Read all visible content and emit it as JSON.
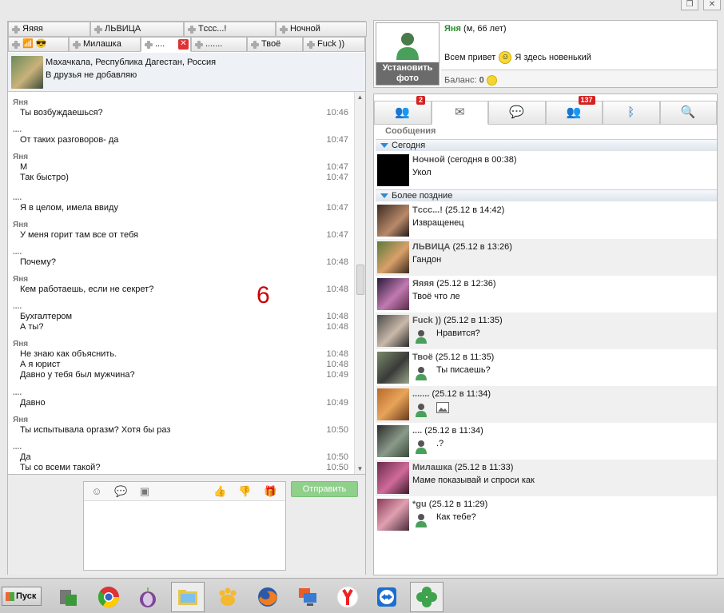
{
  "window_controls": [
    "restore",
    "close"
  ],
  "tabs_row1": [
    {
      "label": "Яяяя"
    },
    {
      "label": "ЛЬВИЦА"
    },
    {
      "label": "Тccc...!"
    },
    {
      "label": "Ночной"
    }
  ],
  "tabs_row2": [
    {
      "label": "😎",
      "emoji_tab": true
    },
    {
      "label": "Милашка"
    },
    {
      "label": "....",
      "active": true
    },
    {
      "label": "......."
    },
    {
      "label": "Твоё"
    },
    {
      "label": "Fuck ))"
    }
  ],
  "profile": {
    "location": "Махачкала, Республика Дагестан, Россия",
    "note": "В друзья не добавляю"
  },
  "messages": [
    {
      "from": "Яня",
      "lines": [
        {
          "text": "Ты возбуждаешься?",
          "time": "10:46"
        }
      ]
    },
    {
      "from": "....",
      "lines": [
        {
          "text": "От таких разговоров- да",
          "time": "10:47"
        }
      ]
    },
    {
      "from": "Яня",
      "lines": [
        {
          "text": "М",
          "time": "10:47"
        },
        {
          "text": "Так быстро)",
          "time": "10:47"
        }
      ]
    },
    {
      "from": "....",
      "lines": [
        {
          "text": "Я в целом, имела ввиду",
          "time": "10:47"
        }
      ]
    },
    {
      "from": "Яня",
      "lines": [
        {
          "text": "У меня горит там все от тебя",
          "time": "10:47"
        }
      ]
    },
    {
      "from": "....",
      "lines": [
        {
          "text": "Почему?",
          "time": "10:48"
        }
      ]
    },
    {
      "from": "Яня",
      "lines": [
        {
          "text": "Кем работаешь, если не секрет?",
          "time": "10:48"
        }
      ]
    },
    {
      "from": "....",
      "lines": [
        {
          "text": "Бухгалтером",
          "time": "10:48"
        },
        {
          "text": "А ты?",
          "time": "10:48"
        }
      ]
    },
    {
      "from": "Яня",
      "lines": [
        {
          "text": "Не знаю как объяснить.",
          "time": "10:48"
        },
        {
          "text": "А я юрист",
          "time": "10:48"
        },
        {
          "text": "Давно у тебя был мужчина?",
          "time": "10:49"
        }
      ]
    },
    {
      "from": "....",
      "lines": [
        {
          "text": "Давно",
          "time": "10:49"
        }
      ]
    },
    {
      "from": "Яня",
      "lines": [
        {
          "text": "Ты испытывала оргазм? Хотя бы раз",
          "time": "10:50"
        }
      ]
    },
    {
      "from": "....",
      "lines": [
        {
          "text": "Да",
          "time": "10:50"
        },
        {
          "text": "Ты со всеми такой?",
          "time": "10:50"
        }
      ]
    }
  ],
  "overlay_number": "6",
  "compose": {
    "send_label": "Отправить",
    "tools": [
      "smiley-icon",
      "speech-bubble-icon",
      "image-icon",
      "thumbs-up-icon",
      "thumbs-down-icon",
      "gift-icon"
    ]
  },
  "me": {
    "name": "Яня",
    "details": "(м, 66 лет)",
    "status_before": "Всем привет",
    "status_after": "Я здесь новенький",
    "balance_label": "Баланс:",
    "balance_value": "0",
    "set_photo_label": "Установить фото"
  },
  "nav_tabs": [
    {
      "icon": "contacts-icon",
      "badge": "2"
    },
    {
      "icon": "envelope-icon",
      "active": true
    },
    {
      "icon": "chat-icon"
    },
    {
      "icon": "group-chat-icon",
      "badge": "137"
    },
    {
      "icon": "bluetooth-people-icon"
    },
    {
      "icon": "search-icon"
    }
  ],
  "messages_title": "Сообщения",
  "groups": {
    "today": "Сегодня",
    "older": "Более поздние"
  },
  "conversations_today": [
    {
      "name": "Ночной",
      "when": "(сегодня в 00:38)",
      "text": "Укол",
      "own": false
    }
  ],
  "conversations_older": [
    {
      "name": "Тccc...!",
      "when": "(25.12 в 14:42)",
      "text": "Извращенец",
      "own": false
    },
    {
      "name": "ЛЬВИЦА",
      "when": "(25.12 в 13:26)",
      "text": "Гандон",
      "own": false
    },
    {
      "name": "Яяяя",
      "when": "(25.12 в 12:36)",
      "text": "Твоё что ле",
      "own": false
    },
    {
      "name": "Fuck ))",
      "when": "(25.12 в 11:35)",
      "text": "Нравится?",
      "own": true
    },
    {
      "name": "Твоё",
      "when": "(25.12 в 11:35)",
      "text": "Ты писаешь?",
      "own": true
    },
    {
      "name": ".......",
      "when": "(25.12 в 11:34)",
      "text": "",
      "own": true,
      "image": true
    },
    {
      "name": "....",
      "when": "(25.12 в 11:34)",
      "text": ".?",
      "own": true
    },
    {
      "name": "Милашка",
      "when": "(25.12 в 11:33)",
      "text": "Маме показывай и спроси как",
      "own": false
    },
    {
      "name": "*gu",
      "when": "(25.12 в 11:29)",
      "text": "Как тебе?",
      "own": true
    }
  ],
  "taskbar": {
    "start_label": "Пуск",
    "apps": [
      "network-icon",
      "chrome-icon",
      "tor-icon",
      "explorer-icon",
      "paw-icon",
      "firefox-icon",
      "remote-desktop-icon",
      "yandex-icon",
      "teamviewer-icon",
      "clover-icon"
    ]
  }
}
